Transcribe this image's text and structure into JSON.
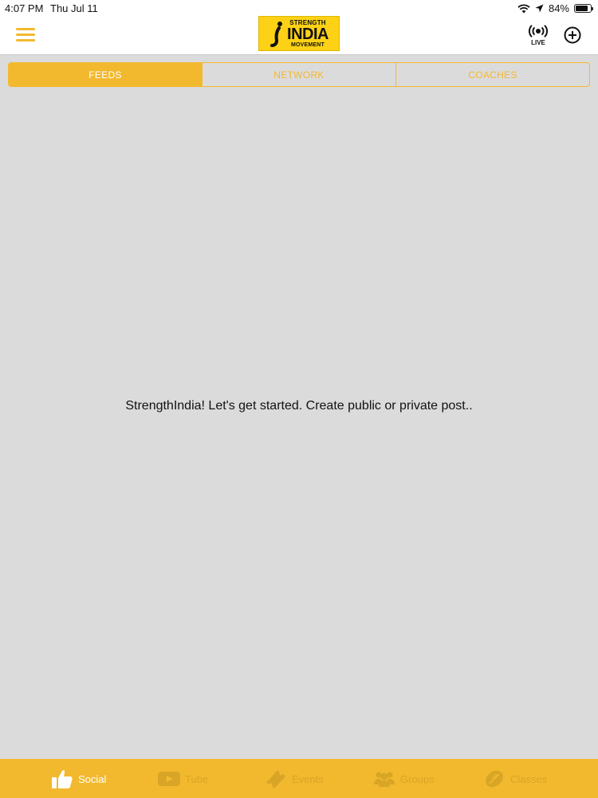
{
  "status_bar": {
    "time": "4:07 PM",
    "date": "Thu Jul 11",
    "battery": "84%",
    "battery_level": 0.84
  },
  "header": {
    "logo": {
      "line1": "STRENGTH",
      "line2": "INDIA",
      "line3": "MOVEMENT"
    },
    "live_label": "LIVE"
  },
  "tabs": [
    {
      "label": "FEEDS",
      "active": true
    },
    {
      "label": "NETWORK",
      "active": false
    },
    {
      "label": "COACHES",
      "active": false
    }
  ],
  "main": {
    "empty_message": "StrengthIndia! Let's get started. Create public or private post.."
  },
  "bottom_nav": [
    {
      "label": "Social",
      "icon": "thumbs-up-icon",
      "active": true
    },
    {
      "label": "Tube",
      "icon": "play-icon",
      "active": false
    },
    {
      "label": "Events",
      "icon": "ticket-icon",
      "active": false
    },
    {
      "label": "Groups",
      "icon": "group-icon",
      "active": false
    },
    {
      "label": "Classes",
      "icon": "ball-icon",
      "active": false
    }
  ],
  "colors": {
    "accent": "#f2b92e",
    "background": "#dcdbdc",
    "logo_yellow": "#fcd116"
  }
}
